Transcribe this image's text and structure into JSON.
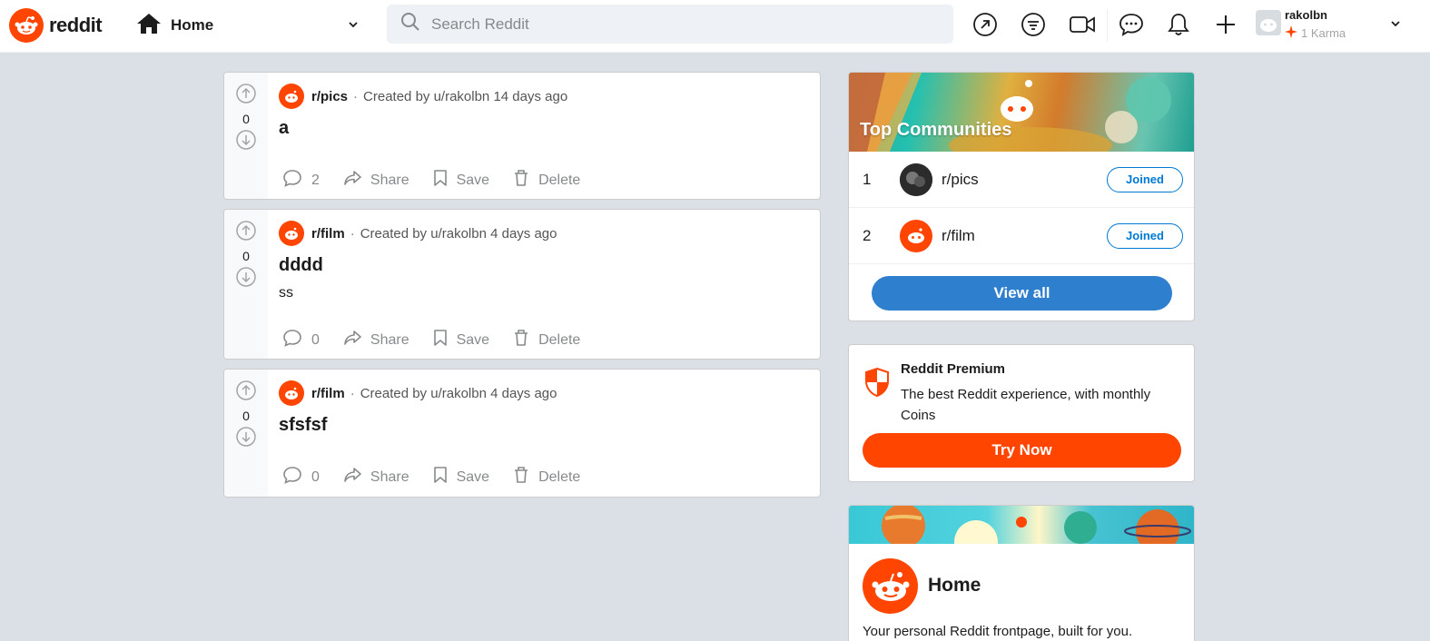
{
  "header": {
    "brand": "reddit",
    "feed_label": "Home",
    "search_placeholder": "Search Reddit",
    "user": {
      "name": "rakolbn",
      "karma": "1 Karma"
    }
  },
  "posts": [
    {
      "votes": "0",
      "subreddit": "r/pics",
      "meta": "Created by u/rakolbn 14 days ago",
      "title": "a",
      "body": "",
      "comments": "2",
      "share": "Share",
      "save": "Save",
      "delete": "Delete"
    },
    {
      "votes": "0",
      "subreddit": "r/film",
      "meta": "Created by u/rakolbn 4 days ago",
      "title": "dddd",
      "body": "ss",
      "comments": "0",
      "share": "Share",
      "save": "Save",
      "delete": "Delete"
    },
    {
      "votes": "0",
      "subreddit": "r/film",
      "meta": "Created by u/rakolbn 4 days ago",
      "title": "sfsfsf",
      "body": "",
      "comments": "0",
      "share": "Share",
      "save": "Save",
      "delete": "Delete"
    }
  ],
  "top_communities": {
    "title": "Top Communities",
    "items": [
      {
        "rank": "1",
        "name": "r/pics",
        "button": "Joined"
      },
      {
        "rank": "2",
        "name": "r/film",
        "button": "Joined"
      }
    ],
    "view_all": "View all"
  },
  "premium": {
    "title": "Reddit Premium",
    "text": "The best Reddit experience, with monthly Coins",
    "button": "Try Now"
  },
  "home_card": {
    "title": "Home",
    "description": "Your personal Reddit frontpage, built for you."
  },
  "colors": {
    "brand": "#ff4500",
    "accent": "#0079d3",
    "background": "#dae0e6"
  }
}
